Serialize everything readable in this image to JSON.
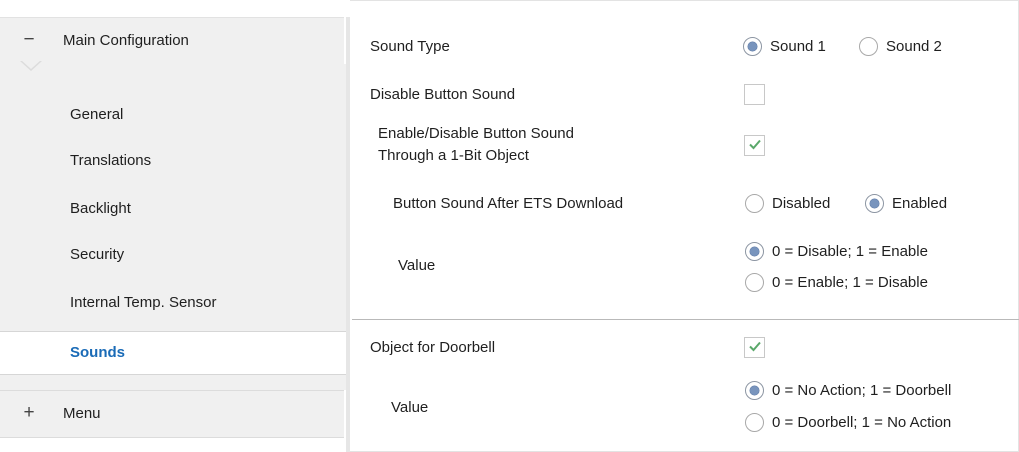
{
  "sidebar": {
    "main_group_label": "Main Configuration",
    "main_group_toggle": "−",
    "items": [
      {
        "label": "General"
      },
      {
        "label": "Translations"
      },
      {
        "label": "Backlight"
      },
      {
        "label": "Security"
      },
      {
        "label": "Internal Temp. Sensor"
      },
      {
        "label": "Sounds",
        "active": true
      }
    ],
    "menu_group_label": "Menu",
    "menu_group_toggle": "+"
  },
  "main": {
    "sound_type": {
      "label": "Sound Type",
      "options": [
        "Sound 1",
        "Sound 2"
      ],
      "selected": "Sound 1"
    },
    "disable_button_sound": {
      "label": "Disable Button Sound",
      "checked": false
    },
    "enable_disable_obj": {
      "label_line1": "Enable/Disable Button Sound",
      "label_line2": "Through a 1-Bit Object",
      "checked": true
    },
    "after_download": {
      "label": "Button Sound After ETS Download",
      "options": [
        "Disabled",
        "Enabled"
      ],
      "selected": "Enabled"
    },
    "value1": {
      "label": "Value",
      "options": [
        "0 = Disable; 1 = Enable",
        "0 = Enable; 1 = Disable"
      ],
      "selected": "0 = Disable; 1 = Enable"
    },
    "doorbell_object": {
      "label": "Object for Doorbell",
      "checked": true
    },
    "value2": {
      "label": "Value",
      "options": [
        "0 = No Action; 1 = Doorbell",
        "0 = Doorbell; 1 = No Action"
      ],
      "selected": "0 = No Action; 1 = Doorbell"
    }
  },
  "colors": {
    "accent_text": "#1a6bb7",
    "radio_fill": "#7894bd",
    "check_green": "#5aa86a",
    "sidebar_bg": "#f0f0f0"
  }
}
